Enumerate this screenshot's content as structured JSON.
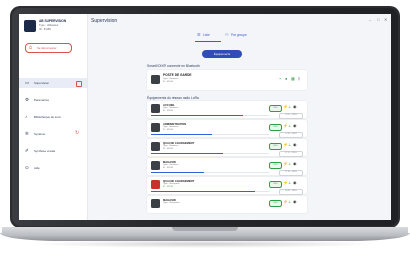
{
  "window": {
    "title": "Supervision",
    "controls": [
      "–",
      "□",
      "✕"
    ]
  },
  "user": {
    "name": "AB SUPERVISION",
    "type": "Type : Utilisateur",
    "id": "ID : 61186"
  },
  "logout": {
    "label": "Se déconnecter",
    "icon": "logout-icon"
  },
  "nav": [
    {
      "label": "Supervision",
      "icon": "monitor-icon",
      "active": true
    },
    {
      "label": "Paramètres",
      "icon": "gear-icon",
      "active": false
    },
    {
      "label": "Bibliothèque de sons",
      "icon": "music-note-icon",
      "active": false
    },
    {
      "label": "Système",
      "icon": "cog-icon",
      "active": false
    },
    {
      "label": "Synthèse vocale",
      "icon": "speech-icon",
      "active": false
    },
    {
      "label": "Aide",
      "icon": "help-icon",
      "active": false
    }
  ],
  "tabs": [
    {
      "label": "Liste",
      "icon": "list-icon"
    },
    {
      "label": "Par groupe",
      "icon": "group-icon"
    }
  ],
  "equipment_button": "Équipements",
  "bluetooth_section": {
    "title": "SmartVOIX® connecté en Bluetooth",
    "device": {
      "name": "POSTE DE GARDE",
      "type": "Type : Emetteur",
      "id": "ID : 61186"
    }
  },
  "radio_section": {
    "title": "Équipements du réseau radio LoRa",
    "devices": [
      {
        "name": "ACCUEIL",
        "type": "Type : Emetteur",
        "id": "ID : 61186",
        "pill": "93%",
        "time": "19:11 - 23/05",
        "progress": 0.78,
        "variant": "dark"
      },
      {
        "name": "ADMINISTRATION",
        "type": "Type : Emetteur",
        "id": "ID : 61186",
        "pill": "93%",
        "time": "17:32 - 23/05",
        "progress": 0.52,
        "variant": "dark"
      },
      {
        "name": "QUAI DE CHARGEMENT",
        "type": "Type : Emetteur",
        "id": "ID : 61186",
        "pill": "93%",
        "time": "17:11 - 23/05",
        "progress": 0.61,
        "variant": "dark"
      },
      {
        "name": "MAGASIN",
        "type": "Type : Emetteur",
        "id": "ID : 61186",
        "pill": "93%",
        "time": "17:03 - 23/05",
        "progress": 0.45,
        "variant": "dark"
      },
      {
        "name": "QUAI DE CHARGEMENT",
        "type": "Type : Récepteur",
        "id": "ID : 61186",
        "pill": "93%",
        "time": "16:59 - 23/05",
        "progress": 0.88,
        "variant": "red"
      },
      {
        "name": "MAGASIN",
        "type": "Type : Récepteur",
        "id": "",
        "pill": "93%",
        "time": "",
        "progress": 0,
        "variant": "dark"
      }
    ]
  },
  "colors": {
    "accent": "#3c5bd6",
    "button": "#2f4db5",
    "ok": "#2e9e49",
    "alert": "#d9534f",
    "progress": "#2f63d6"
  }
}
